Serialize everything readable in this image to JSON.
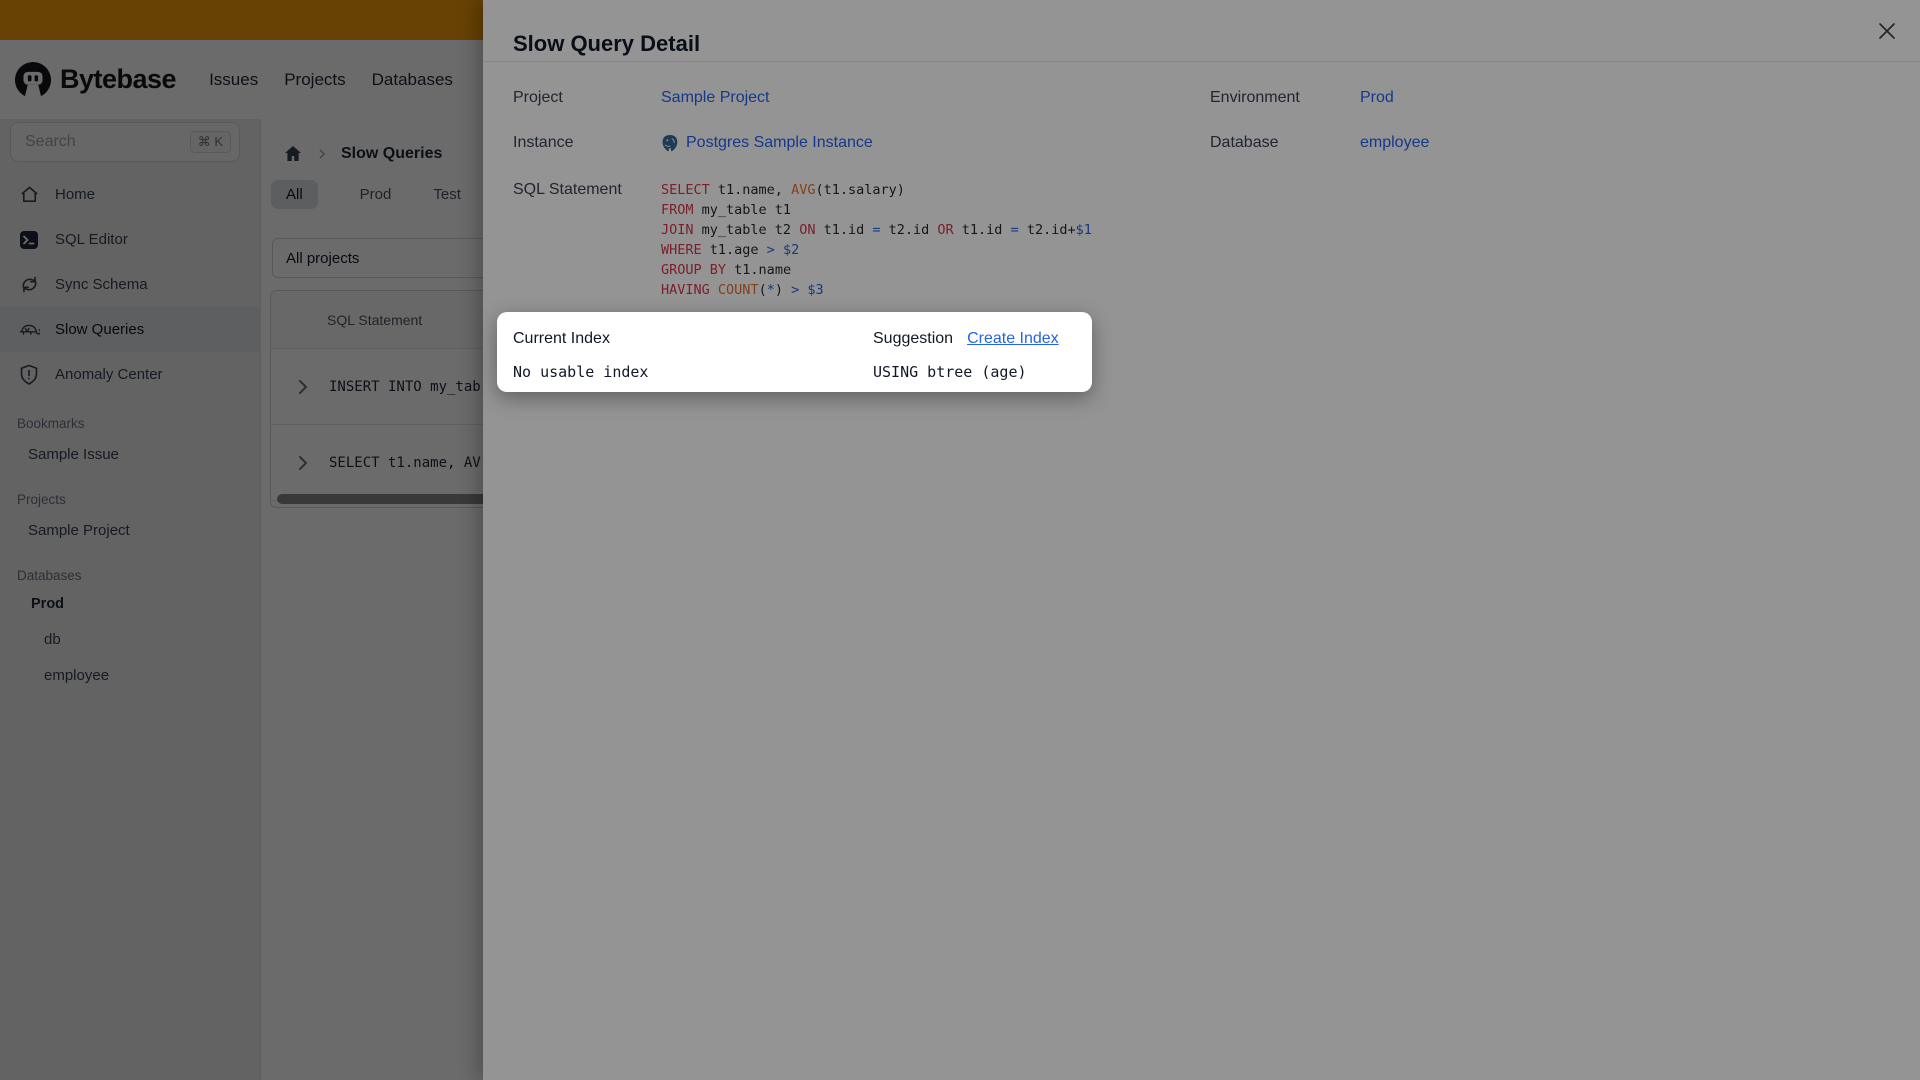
{
  "banner": {
    "color": "#f59e0b"
  },
  "header": {
    "logo_text": "Bytebase",
    "nav": [
      "Issues",
      "Projects",
      "Databases"
    ]
  },
  "sidebar": {
    "search": {
      "placeholder": "Search",
      "shortcut": "⌘ K"
    },
    "items": [
      {
        "kind": "item",
        "icon": "home-icon",
        "label": "Home"
      },
      {
        "kind": "item",
        "icon": "sql-editor-icon",
        "label": "SQL Editor"
      },
      {
        "kind": "item",
        "icon": "sync-schema-icon",
        "label": "Sync Schema"
      },
      {
        "kind": "item",
        "icon": "slow-queries-icon",
        "label": "Slow Queries",
        "active": true
      },
      {
        "kind": "item",
        "icon": "anomaly-center-icon",
        "label": "Anomaly Center"
      },
      {
        "kind": "section",
        "label": "Bookmarks"
      },
      {
        "kind": "link",
        "label": "Sample Issue"
      },
      {
        "kind": "section",
        "label": "Projects"
      },
      {
        "kind": "link",
        "label": "Sample Project"
      },
      {
        "kind": "section",
        "label": "Databases"
      },
      {
        "kind": "env",
        "label": "Prod"
      },
      {
        "kind": "db",
        "label": "db"
      },
      {
        "kind": "db",
        "label": "employee"
      }
    ]
  },
  "main": {
    "breadcrumb": {
      "page": "Slow Queries"
    },
    "tabs": {
      "items": [
        "All",
        "Prod",
        "Test"
      ],
      "active": "All"
    },
    "project_filter": "All projects",
    "table": {
      "header": "SQL Statement",
      "rows": [
        {
          "sql": "INSERT INTO my_tab"
        },
        {
          "sql": "SELECT t1.name, AV"
        }
      ]
    }
  },
  "modal": {
    "title": "Slow Query Detail",
    "fields": [
      {
        "label": "Project",
        "value": "Sample Project"
      },
      {
        "label": "Environment",
        "value": "Prod"
      },
      {
        "label": "Instance",
        "value": "Postgres Sample Instance",
        "icon": "postgres-icon"
      },
      {
        "label": "Database",
        "value": "employee"
      }
    ],
    "sql_label": "SQL Statement",
    "sql_lines": [
      [
        {
          "c": "kw",
          "t": "SELECT"
        },
        {
          "c": "id",
          "t": " t1.name, "
        },
        {
          "c": "fn",
          "t": "AVG"
        },
        {
          "c": "pu",
          "t": "("
        },
        {
          "c": "id",
          "t": "t1.salary"
        },
        {
          "c": "pu",
          "t": ")"
        }
      ],
      [
        {
          "c": "kw",
          "t": "FROM"
        },
        {
          "c": "id",
          "t": " my_table t1"
        }
      ],
      [
        {
          "c": "kw",
          "t": "JOIN"
        },
        {
          "c": "id",
          "t": " my_table t2 "
        },
        {
          "c": "kw",
          "t": "ON"
        },
        {
          "c": "id",
          "t": " t1.id "
        },
        {
          "c": "op",
          "t": "="
        },
        {
          "c": "id",
          "t": " t2.id "
        },
        {
          "c": "kw",
          "t": "OR"
        },
        {
          "c": "id",
          "t": " t1.id "
        },
        {
          "c": "op",
          "t": "="
        },
        {
          "c": "id",
          "t": " t2.id"
        },
        {
          "c": "pu",
          "t": "+"
        },
        {
          "c": "pr",
          "t": "$1"
        }
      ],
      [
        {
          "c": "kw",
          "t": "WHERE"
        },
        {
          "c": "id",
          "t": " t1.age "
        },
        {
          "c": "op",
          "t": ">"
        },
        {
          "c": "id",
          "t": " "
        },
        {
          "c": "pr",
          "t": "$2"
        }
      ],
      [
        {
          "c": "kw",
          "t": "GROUP"
        },
        {
          "c": "id",
          "t": " "
        },
        {
          "c": "kw",
          "t": "BY"
        },
        {
          "c": "id",
          "t": " t1.name"
        }
      ],
      [
        {
          "c": "kw",
          "t": "HAVING"
        },
        {
          "c": "id",
          "t": " "
        },
        {
          "c": "fn",
          "t": "COUNT"
        },
        {
          "c": "pu",
          "t": "("
        },
        {
          "c": "op",
          "t": "*"
        },
        {
          "c": "pu",
          "t": ")"
        },
        {
          "c": "id",
          "t": " "
        },
        {
          "c": "op",
          "t": ">"
        },
        {
          "c": "id",
          "t": " "
        },
        {
          "c": "pr",
          "t": "$3"
        }
      ]
    ]
  },
  "popover": {
    "current_index_label": "Current Index",
    "current_index_value": "No usable index",
    "suggestion_label": "Suggestion",
    "create_index_link": "Create Index",
    "suggestion_value": "USING btree (age)"
  },
  "colors": {
    "banner": "#f59e0b",
    "link": "#2563eb",
    "sql_keyword": "#d63649",
    "sql_function": "#e0702f",
    "sql_operator": "#2b62d9",
    "postgres_blue": "#336791"
  }
}
